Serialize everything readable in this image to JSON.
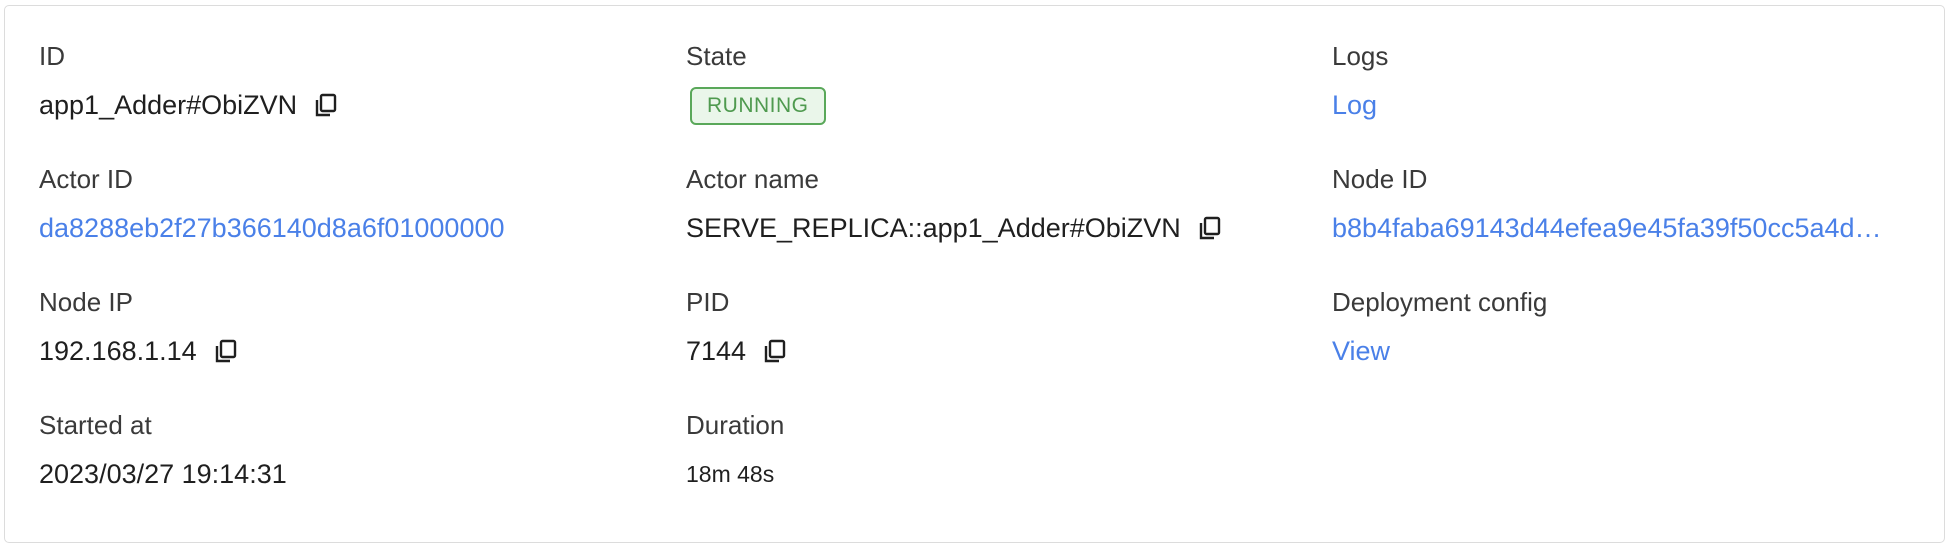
{
  "fields": {
    "id": {
      "label": "ID",
      "value": "app1_Adder#ObiZVN"
    },
    "state": {
      "label": "State",
      "value": "RUNNING"
    },
    "logs": {
      "label": "Logs",
      "value": "Log"
    },
    "actor_id": {
      "label": "Actor ID",
      "value": "da8288eb2f27b366140d8a6f01000000"
    },
    "actor_name": {
      "label": "Actor name",
      "value": "SERVE_REPLICA::app1_Adder#ObiZVN"
    },
    "node_id": {
      "label": "Node ID",
      "value": "b8b4faba69143d44efea9e45fa39f50cc5a4d…"
    },
    "node_ip": {
      "label": "Node IP",
      "value": "192.168.1.14"
    },
    "pid": {
      "label": "PID",
      "value": "7144"
    },
    "deployment_config": {
      "label": "Deployment config",
      "value": "View"
    },
    "started_at": {
      "label": "Started at",
      "value": "2023/03/27 19:14:31"
    },
    "duration": {
      "label": "Duration",
      "value": "18m 48s"
    }
  },
  "icons": {
    "copy": "copy-icon"
  },
  "colors": {
    "link": "#4a80e8",
    "running_border": "#5aa85a",
    "running_bg": "#eaf6ea",
    "running_text": "#4f9a4f"
  }
}
